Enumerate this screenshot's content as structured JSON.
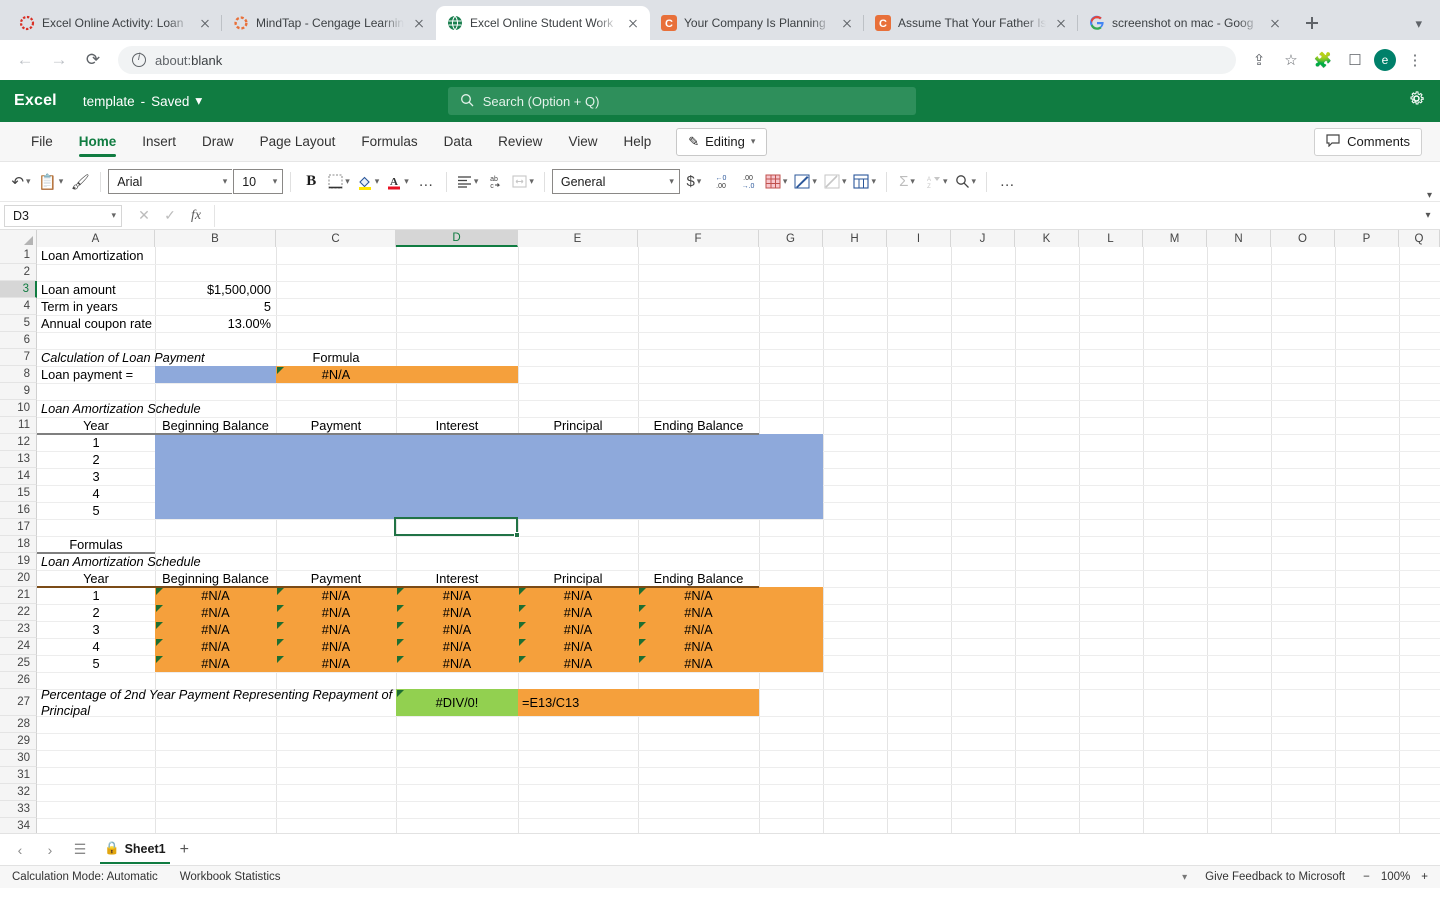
{
  "browser": {
    "tabs": [
      {
        "title": "Excel Online Activity: Loan",
        "favicon": "ring-icon",
        "active": false
      },
      {
        "title": "MindTap - Cengage Learnin",
        "favicon": "mindtap-icon",
        "active": false
      },
      {
        "title": "Excel Online Student Work",
        "favicon": "globe-icon",
        "active": true
      },
      {
        "title": "Your Company Is Planning",
        "favicon": "cengage-icon",
        "active": false
      },
      {
        "title": "Assume That Your Father Is",
        "favicon": "cengage-icon",
        "active": false
      },
      {
        "title": "screenshot on mac - Goog",
        "favicon": "google-icon",
        "active": false
      }
    ],
    "new_tab_label": "+",
    "back_label": "←",
    "forward_label": "→",
    "reload_label": "⟳",
    "url": "about:blank",
    "url_prefix": "about:",
    "url_suffix": "blank",
    "profile_initial": "e"
  },
  "excel": {
    "app_name": "Excel",
    "doc_name": "template",
    "doc_separator": "-",
    "save_state": "Saved",
    "search_placeholder": "Search (Option + Q)",
    "ribbon_tabs": [
      {
        "label": "File",
        "active": false
      },
      {
        "label": "Home",
        "active": true
      },
      {
        "label": "Insert",
        "active": false
      },
      {
        "label": "Draw",
        "active": false
      },
      {
        "label": "Page Layout",
        "active": false
      },
      {
        "label": "Formulas",
        "active": false
      },
      {
        "label": "Data",
        "active": false
      },
      {
        "label": "Review",
        "active": false
      },
      {
        "label": "View",
        "active": false
      },
      {
        "label": "Help",
        "active": false
      }
    ],
    "editing_label": "Editing",
    "comments_label": "Comments",
    "toolbar": {
      "font_name": "Arial",
      "font_size": "10",
      "bold_label": "B",
      "number_format": "General",
      "currency_label": "$",
      "decrease_decimal_label": "←.0\n.00",
      "increase_decimal_label": ".00\n→.0",
      "more_label": "…"
    },
    "name_box": "D3",
    "formula_value": "",
    "sheet": {
      "tab_name": "Sheet1",
      "add_label": "+"
    },
    "status": {
      "calc_mode": "Calculation Mode: Automatic",
      "workbook_stats": "Workbook Statistics",
      "feedback": "Give Feedback to Microsoft",
      "zoom": "100%",
      "zoom_out": "−",
      "zoom_in": "+"
    }
  },
  "grid": {
    "columns": [
      "A",
      "B",
      "C",
      "D",
      "E",
      "F",
      "G",
      "H",
      "I",
      "J",
      "K",
      "L",
      "M",
      "N",
      "O",
      "P",
      "Q"
    ],
    "selected_column": "D",
    "selected_row": 3,
    "rows": [
      1,
      2,
      3,
      4,
      5,
      6,
      7,
      8,
      9,
      10,
      11,
      12,
      13,
      14,
      15,
      16,
      17,
      18,
      19,
      20,
      21,
      22,
      23,
      24,
      25,
      26,
      27,
      28,
      29,
      30,
      31,
      32,
      33
    ],
    "cells": {
      "A1": "Loan Amortization",
      "A3": "Loan amount",
      "B3": "$1,500,000",
      "A4": "Term in years",
      "B4": "5",
      "A5": "Annual coupon rate",
      "B5": "13.00%",
      "A7": "Calculation of Loan Payment",
      "C7": "Formula",
      "A8": "Loan payment =",
      "C8": "#N/A",
      "A10": "Loan Amortization Schedule",
      "A11": "Year",
      "B11": "Beginning Balance",
      "C11": "Payment",
      "D11": "Interest",
      "E11": "Principal",
      "F11": "Ending Balance",
      "A12": "1",
      "A13": "2",
      "A14": "3",
      "A15": "4",
      "A16": "5",
      "A18": "Formulas",
      "A19": "Loan Amortization Schedule",
      "A20": "Year",
      "B20": "Beginning Balance",
      "C20": "Payment",
      "D20": "Interest",
      "E20": "Principal",
      "F20": "Ending Balance",
      "A21": "1",
      "B21": "#N/A",
      "C21": "#N/A",
      "D21": "#N/A",
      "E21": "#N/A",
      "F21": "#N/A",
      "A22": "2",
      "B22": "#N/A",
      "C22": "#N/A",
      "D22": "#N/A",
      "E22": "#N/A",
      "F22": "#N/A",
      "A23": "3",
      "B23": "#N/A",
      "C23": "#N/A",
      "D23": "#N/A",
      "E23": "#N/A",
      "F23": "#N/A",
      "A24": "4",
      "B24": "#N/A",
      "C24": "#N/A",
      "D24": "#N/A",
      "E24": "#N/A",
      "F24": "#N/A",
      "A25": "5",
      "B25": "#N/A",
      "C25": "#N/A",
      "D25": "#N/A",
      "E25": "#N/A",
      "F25": "#N/A",
      "A27": "Percentage of 2nd Year Payment Representing Repayment of Principal",
      "D27": "#DIV/0!",
      "E27": "=E13/C13"
    },
    "colors": {
      "blue_input": "#8ea9db",
      "orange_formula": "#f5a03c",
      "green_result": "#92d050",
      "error_triangle": "#1e6e31",
      "accent_green": "#107c41"
    }
  }
}
